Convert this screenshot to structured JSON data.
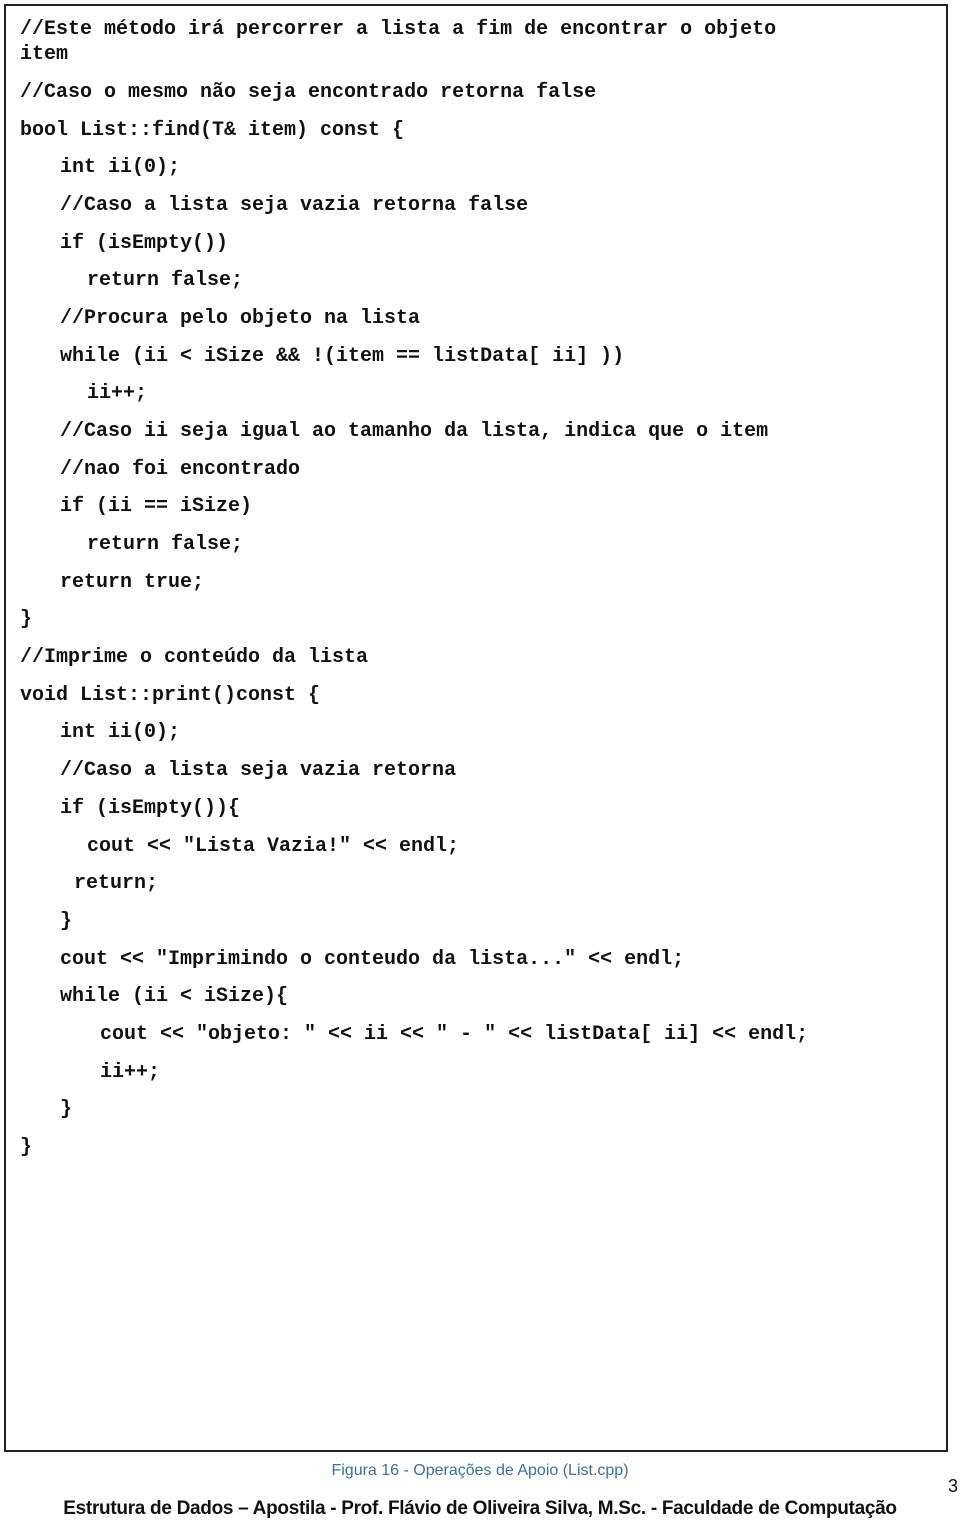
{
  "code_lines": [
    {
      "text": "//Este método irá percorrer a lista a fim de encontrar o objeto",
      "indent": 0
    },
    {
      "text": "item",
      "indent": 0
    },
    {
      "text": "//Caso o mesmo não seja encontrado retorna false",
      "indent": 0
    },
    {
      "text": "bool List::find(T& item) const {",
      "indent": 0
    },
    {
      "text": "int ii(0);",
      "indent": 1
    },
    {
      "text": "//Caso a lista seja vazia retorna false",
      "indent": 1
    },
    {
      "text": "if (isEmpty())",
      "indent": 1
    },
    {
      "text": "return false;",
      "indent": 2
    },
    {
      "text": "//Procura pelo objeto na lista",
      "indent": 1
    },
    {
      "text": "while (ii < iSize && !(item == listData[ ii] ))",
      "indent": 1
    },
    {
      "text": "ii++;",
      "indent": 2
    },
    {
      "text": "//Caso ii seja igual ao tamanho da lista, indica que o item",
      "indent": 1
    },
    {
      "text": "//nao foi encontrado",
      "indent": 1
    },
    {
      "text": "if (ii == iSize)",
      "indent": 1
    },
    {
      "text": "return false;",
      "indent": 2
    },
    {
      "text": "return true;",
      "indent": 1
    },
    {
      "text": "}",
      "indent": 0
    },
    {
      "text": "//Imprime o conteúdo da lista",
      "indent": 0
    },
    {
      "text": "void List::print()const {",
      "indent": 0
    },
    {
      "text": "int ii(0);",
      "indent": 1
    },
    {
      "text": "//Caso a lista seja vazia retorna",
      "indent": 1
    },
    {
      "text": "if (isEmpty()){",
      "indent": 1
    },
    {
      "text": "cout << \"Lista Vazia!\" << endl;",
      "indent": 2
    },
    {
      "text": "return;",
      "indent": 1.5
    },
    {
      "text": "}",
      "indent": 1
    },
    {
      "text": "cout << \"Imprimindo o conteudo da lista...\" << endl;",
      "indent": 1
    },
    {
      "text": "while (ii < iSize){",
      "indent": 1
    },
    {
      "text": "cout << \"objeto: \" << ii << \" - \" << listData[ ii] << endl;",
      "indent": 2.5
    },
    {
      "text": "ii++;",
      "indent": 2.5
    },
    {
      "text": "}",
      "indent": 1
    },
    {
      "text": "}",
      "indent": 0
    }
  ],
  "caption": "Figura 16 - Operações de Apoio (List.cpp)",
  "page_number": "3",
  "footer": "Estrutura de Dados – Apostila - Prof. Flávio de Oliveira Silva, M.Sc. - Faculdade de Computação"
}
